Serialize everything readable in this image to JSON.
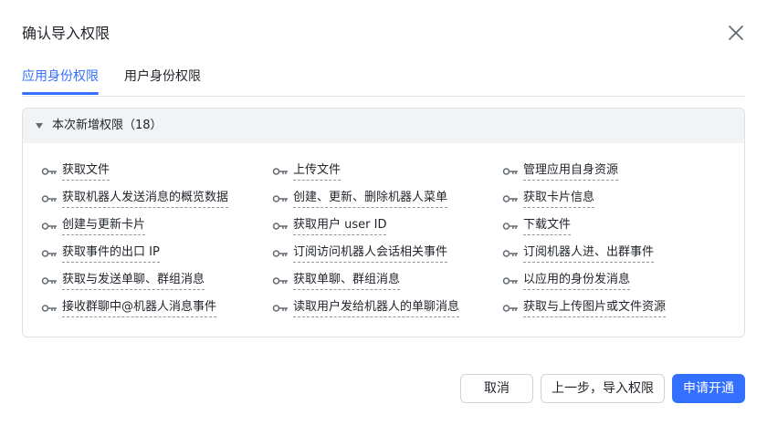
{
  "dialog": {
    "title": "确认导入权限",
    "close_icon": "close-icon"
  },
  "tabs": [
    {
      "label": "应用身份权限",
      "active": true
    },
    {
      "label": "用户身份权限",
      "active": false
    }
  ],
  "panel": {
    "title": "本次新增权限（18）",
    "expanded": true,
    "permissions": [
      [
        "获取文件",
        "上传文件",
        "管理应用自身资源"
      ],
      [
        "获取机器人发送消息的概览数据",
        "创建、更新、删除机器人菜单",
        "获取卡片信息"
      ],
      [
        "创建与更新卡片",
        "获取用户 user ID",
        "下载文件"
      ],
      [
        "获取事件的出口 IP",
        "订阅访问机器人会话相关事件",
        "订阅机器人进、出群事件"
      ],
      [
        "获取与发送单聊、群组消息",
        "获取单聊、群组消息",
        "以应用的身份发消息"
      ],
      [
        "接收群聊中@机器人消息事件",
        "读取用户发给机器人的单聊消息",
        "获取与上传图片或文件资源"
      ]
    ]
  },
  "footer": {
    "cancel_label": "取消",
    "prev_label": "上一步，导入权限",
    "submit_label": "申请开通"
  },
  "colors": {
    "accent": "#3370ff",
    "text": "#1f2329",
    "border": "#dee0e3",
    "panel_header_bg": "#f2f3f5"
  }
}
